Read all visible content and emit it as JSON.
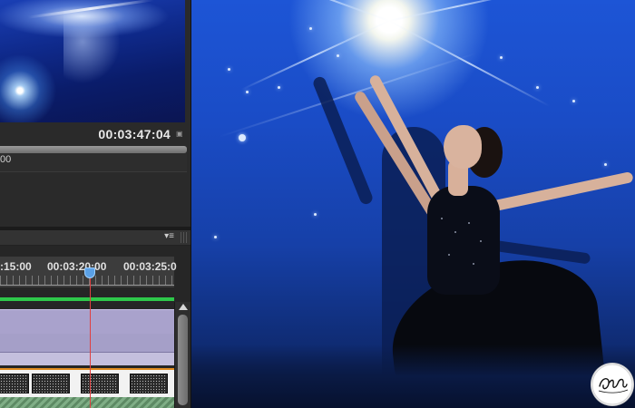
{
  "editor": {
    "program_monitor": {
      "timecode": "00:03:47:04",
      "scrubber_label": "00"
    },
    "timeline": {
      "ruler_labels": [
        ":15:00",
        "00:03:20:00",
        "00:03:25:0"
      ]
    }
  },
  "colors": {
    "work_area_bar": "#2ec84a",
    "playhead": "#5aa0e6",
    "playhead_line": "#e04040",
    "clip_border": "#e08a1e",
    "track_purple": "#a9a2cc",
    "photo_background": "#1a4cc6"
  },
  "icons": {
    "timecode_menu": "small-square-icon",
    "panel_menu": "panel-menu-icon",
    "panel_grip": "grip-icon",
    "playhead": "playhead-marker-icon",
    "scroll_up": "triangle-up-icon",
    "logo": "photographer-logo"
  },
  "photo": {
    "description_logo_text": "GinBuck"
  }
}
